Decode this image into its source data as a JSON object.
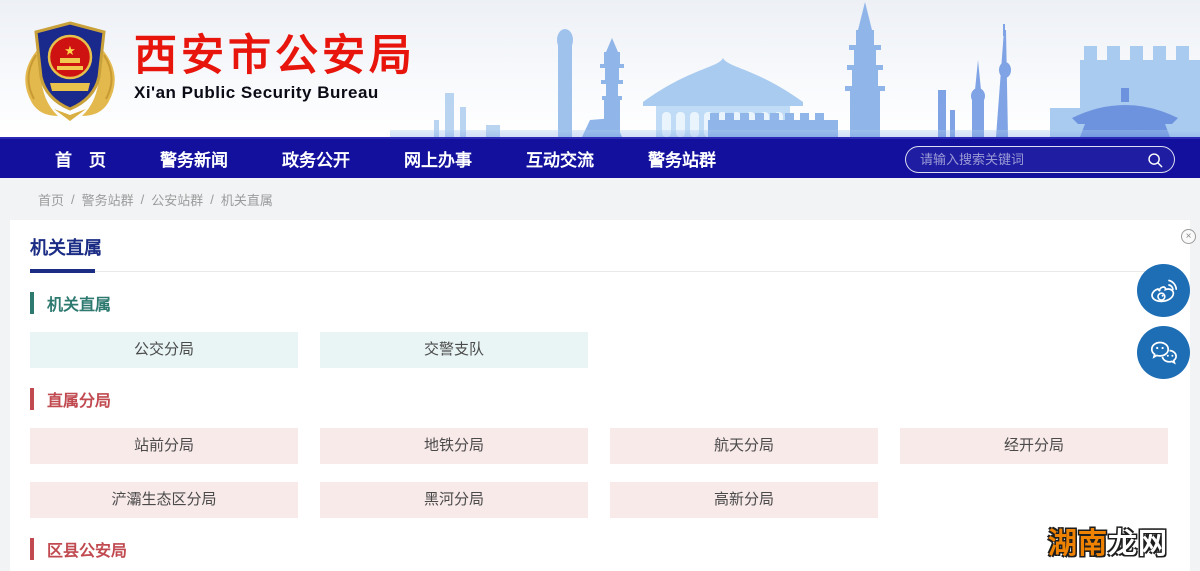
{
  "header": {
    "title": "西安市公安局",
    "subtitle": "Xi'an Public Security Bureau",
    "logo_icon": "police-emblem-icon"
  },
  "nav": {
    "items": [
      {
        "name": "home",
        "label": "首　页"
      },
      {
        "name": "news",
        "label": "警务新闻"
      },
      {
        "name": "gov-open",
        "label": "政务公开"
      },
      {
        "name": "online-services",
        "label": "网上办事"
      },
      {
        "name": "interaction",
        "label": "互动交流"
      },
      {
        "name": "station-group",
        "label": "警务站群"
      }
    ],
    "search": {
      "placeholder": "请输入搜索关键词",
      "icon": "search-icon"
    }
  },
  "breadcrumb": {
    "separator": "/",
    "items": [
      "首页",
      "警务站群",
      "公安站群",
      "机关直属"
    ]
  },
  "page": {
    "title": "机关直属"
  },
  "sections": [
    {
      "name": "organ-direct",
      "title": "机关直属",
      "accent": "#2E7A70",
      "link_bg": "#E9F4F4",
      "links": [
        "公交分局",
        "交警支队"
      ]
    },
    {
      "name": "direct-branches",
      "title": "直属分局",
      "accent": "#C04A50",
      "link_bg": "#F9EAEA",
      "links": [
        "站前分局",
        "地铁分局",
        "航天分局",
        "经开分局",
        "浐灞生态区分局",
        "黑河分局",
        "高新分局"
      ]
    },
    {
      "name": "district-county-bureaus",
      "title": "区县公安局",
      "accent": "#C04A50",
      "link_bg": "#F9EAEA",
      "links": []
    }
  ],
  "floating": {
    "close_icon": "×",
    "icons": [
      "weibo-icon",
      "wechat-icon"
    ]
  },
  "watermark": {
    "part1": "湖南",
    "part2": "龙网"
  },
  "colors": {
    "nav_bg": "#12109D",
    "title_red": "#E8150D",
    "page_title_navy": "#1B2C85",
    "teal_accent": "#2E7A70",
    "red_accent": "#C04A50",
    "circle_blue": "#1E6EB5"
  }
}
